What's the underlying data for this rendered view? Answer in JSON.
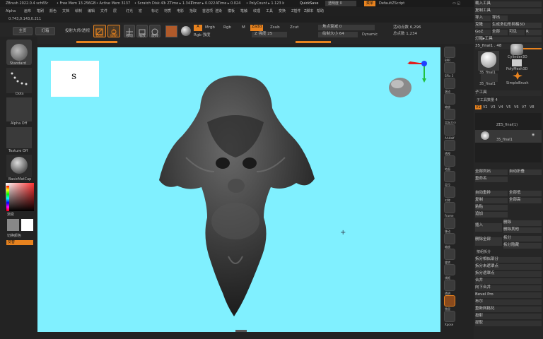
{
  "app": {
    "title_info": "ZBrush 2022.0.4 sch65r",
    "free_mem": "• Free Mem 13.256GB",
    "active_mem": "• Active Mem 3137",
    "scratch_disk": "• Scratch Disk 43",
    "ztime": "• ZTime ▸ 1.341",
    "timer": "Timer ▸ 0.022",
    "atime": "ATime ▸ 0.024",
    "polycount": "• PolyCount ▸ 1.123 k",
    "quicksave": "QuickSave",
    "transparency": "透明度 0",
    "menu_btn": "菜单",
    "default_script": "DefaultZScript"
  },
  "menubar": {
    "items": [
      "Alpha",
      "画布",
      "笔刷",
      "颜色",
      "文档",
      "绘制",
      "编辑",
      "文件",
      "层",
      "灯光",
      "宏",
      "标记",
      "材质",
      "电影",
      "拾取",
      "首选项",
      "渲染",
      "模板",
      "笔触",
      "纹理",
      "工具",
      "变换",
      "Z插件",
      "Z脚本",
      "帮助"
    ]
  },
  "infobar": {
    "coords": "0.743,0.143,0.211"
  },
  "toolbar": {
    "home": "主页",
    "lightbox": "灯箱",
    "projection_master": "投射大师/透视",
    "edit": "Edit",
    "draw": "绘制",
    "move": "移动",
    "scale": "缩放",
    "rotate": "旋转",
    "a_label": "A",
    "mrgb": "Mrgb",
    "rgb": "Rgb",
    "m": "M",
    "zadd": "Zadd",
    "zsub": "Zsub",
    "zcut": "Zcut",
    "rgb_intensity": "Rgb 强度",
    "z_intensity": "Z 强度 25",
    "focal_shift": "焦点衰减 0",
    "draw_size": "绘制大小 64",
    "dynamic": "Dynamic",
    "active_points": "活动点数 6,296",
    "total_points": "总点数 1,234"
  },
  "left": {
    "standard": "Standard",
    "dots": "Dots",
    "alpha_off": "Alpha Off",
    "texture_off": "Texture Off",
    "material": "BasicMatCap",
    "gradient": "渐变",
    "switch_color": "切换颜色",
    "alternate": "交替"
  },
  "right_tools": [
    "BPR",
    "SPix 3",
    "滚动",
    "缩放",
    "实际大小",
    "AAHalf",
    "透视",
    "地面",
    "定位",
    "对称",
    "Frame",
    "移动",
    "缩放",
    "旋转",
    "线框",
    "透明",
    "独显",
    "Xpose"
  ],
  "right_panel": {
    "header1": "载入工具",
    "header2": "复制工具",
    "import": "导入",
    "export": "导出",
    "clone": "克隆",
    "make_polymesh": "生成多边形网格3D",
    "goz": "GoZ",
    "all": "全部",
    "visible": "可见",
    "r": "R",
    "lightbox_tools": "灯箱▸工具",
    "current_tool": "35_final1 . 48",
    "thumb1_label": "35_final1",
    "thumb2_label": "Cylinder3D",
    "thumb3_label": "PolyMesh3D",
    "thumb4_label": "35_final1",
    "thumb5_label": "SimpleBrush",
    "subtool_header": "子工具",
    "subtool_count": "子工具数量 4",
    "versions": [
      "V1",
      "V2",
      "V3",
      "V4",
      "V5",
      "V6",
      "V7",
      "V8"
    ],
    "subtool1": "ZES_final(1)",
    "subtool2": "35_final1",
    "list_all": "全部列出",
    "auto_collapse": "自动折叠",
    "rename": "重命名",
    "auto_reorder": "自动重排",
    "all_low": "全部低",
    "all_high": "全部高",
    "copy": "复制",
    "paste": "粘贴",
    "append": "追加",
    "insert": "插入",
    "delete": "删除",
    "delete_other": "删除其他",
    "delete_all": "删除全部",
    "split": "拆分",
    "split_hidden": "拆分隐藏",
    "split_parts": "按组拆分",
    "split_similar": "拆分相似部分",
    "split_unmasked": "拆分未遮罩点",
    "split_masked": "拆分遮罩点",
    "merge": "合并",
    "merge_down": "向下合并",
    "bevel_pro": "Bevel Pro",
    "boolean": "布尔",
    "remesh": "重新网格化",
    "project": "投射",
    "extract": "提取"
  },
  "canvas": {
    "color": "#80f0ff",
    "note": "s"
  },
  "colors": {
    "accent": "#e8831f",
    "canvas": "#80f0ff",
    "panel": "#262626"
  }
}
